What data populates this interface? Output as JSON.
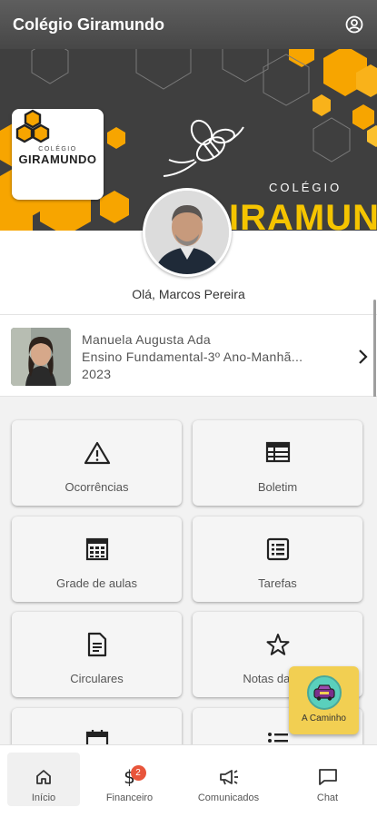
{
  "app": {
    "title": "Colégio Giramundo"
  },
  "banner": {
    "logo_small": "COLÉGIO",
    "logo_name": "GIRAMUNDO",
    "word1": "COLÉGIO",
    "word2": "IRAMUNDO"
  },
  "user": {
    "greeting": "Olá, Marcos Pereira"
  },
  "student": {
    "name": "Manuela Augusta Ada",
    "grade": "Ensino Fundamental-3º Ano-Manhã...",
    "year": "2023"
  },
  "menu": [
    {
      "label": "Ocorrências",
      "icon": "warning-icon"
    },
    {
      "label": "Boletim",
      "icon": "table-icon"
    },
    {
      "label": "Grade de aulas",
      "icon": "calendar-grid-icon"
    },
    {
      "label": "Tarefas",
      "icon": "task-list-icon"
    },
    {
      "label": "Circulares",
      "icon": "document-icon"
    },
    {
      "label": "Notas das Av",
      "icon": "star-icon"
    },
    {
      "label": "",
      "icon": "calendar-icon"
    },
    {
      "label": "",
      "icon": "list-icon"
    }
  ],
  "fab": {
    "label": "A Caminho",
    "icon": "car-icon"
  },
  "nav": [
    {
      "label": "Início",
      "icon": "home-icon"
    },
    {
      "label": "Financeiro",
      "icon": "dollar-icon",
      "badge": "2"
    },
    {
      "label": "Comunicados",
      "icon": "megaphone-icon"
    },
    {
      "label": "Chat",
      "icon": "chat-icon"
    }
  ],
  "colors": {
    "appbar": "#4f4f4f",
    "honey": "#f7a500",
    "badge": "#e8553b",
    "fab": "#f2cf52"
  }
}
